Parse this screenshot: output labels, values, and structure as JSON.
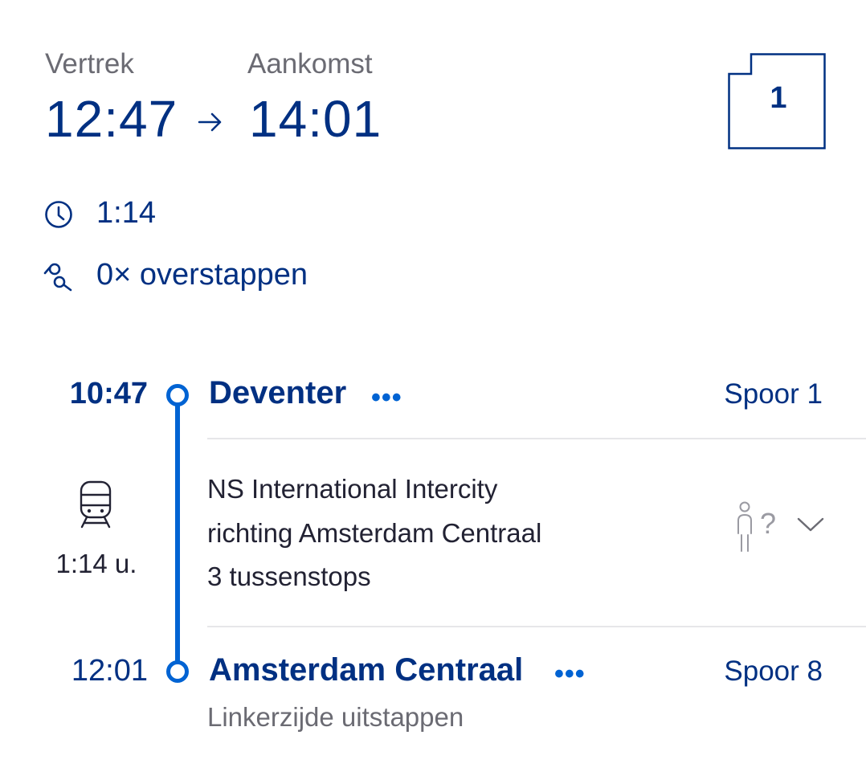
{
  "header": {
    "departure_label": "Vertrek",
    "arrival_label": "Aankomst",
    "departure_time": "12:47",
    "arrival_time": "14:01",
    "class": "1"
  },
  "summary": {
    "duration": "1:14",
    "transfers": "0× overstappen"
  },
  "journey": {
    "departure": {
      "time": "10:47",
      "station": "Deventer",
      "more": "•••",
      "platform": "Spoor 1"
    },
    "leg": {
      "train_type": "NS International Intercity",
      "direction": "richting Amsterdam Centraal",
      "stops": "3 tussenstops",
      "duration": "1:14 u.",
      "crowd_indicator": "?"
    },
    "arrival": {
      "time": "12:01",
      "station": "Amsterdam Centraal",
      "more": "•••",
      "platform": "Spoor 8",
      "note": "Linkerzijde uitstappen"
    }
  },
  "icons": {
    "arrow": "arrow-right-icon",
    "clock": "clock-icon",
    "transfer": "transfer-icon",
    "train": "train-icon",
    "person": "person-icon",
    "chevron": "chevron-down-icon"
  },
  "colors": {
    "primary": "#003082",
    "accent": "#0063d3",
    "muted": "#6b6b73"
  }
}
